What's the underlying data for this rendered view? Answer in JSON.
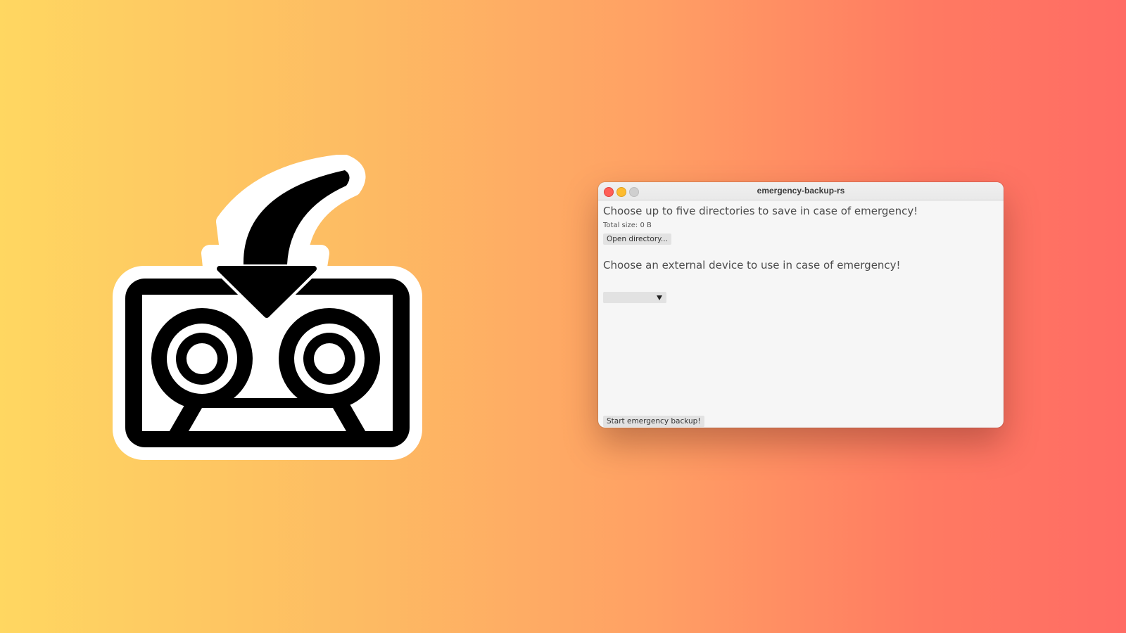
{
  "window": {
    "title": "emergency-backup-rs"
  },
  "directories": {
    "heading": "Choose up to five directories to save in case of emergency!",
    "total_size": "Total size: 0 B",
    "open_button": "Open directory..."
  },
  "device": {
    "heading": "Choose an external device to use in case of emergency!",
    "selected": "",
    "options": []
  },
  "actions": {
    "start_button": "Start emergency backup!"
  },
  "logo": {
    "icon": "cassette-tape-download-icon"
  },
  "colors": {
    "background_start": "#ffd761",
    "background_end": "#ff6c64",
    "window_bg": "#f6f6f6",
    "close": "#ff5f57",
    "minimize": "#febc2e",
    "maximize": "#cfcfcf"
  }
}
